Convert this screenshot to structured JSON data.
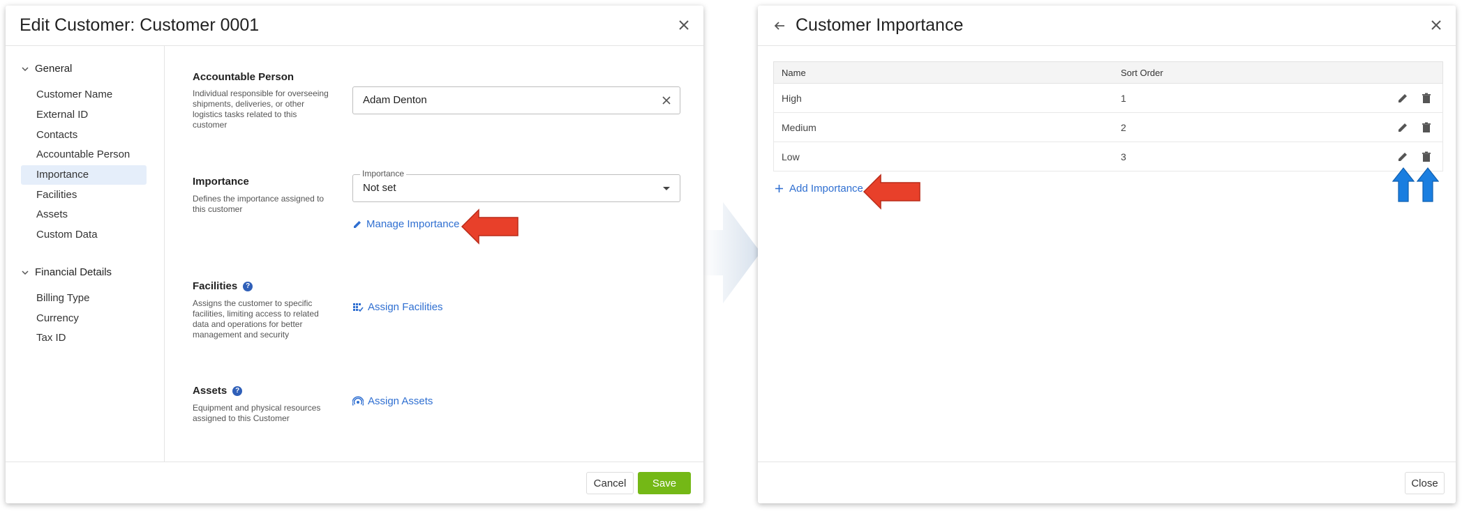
{
  "left_dialog": {
    "title": "Edit Customer: Customer 0001",
    "nav": {
      "general_label": "General",
      "general_items": [
        "Customer Name",
        "External ID",
        "Contacts",
        "Accountable Person",
        "Importance",
        "Facilities",
        "Assets",
        "Custom Data"
      ],
      "active_item": "Importance",
      "financial_label": "Financial Details",
      "financial_items": [
        "Billing Type",
        "Currency",
        "Tax ID"
      ]
    },
    "accountable": {
      "title": "Accountable Person",
      "description": "Individual responsible for overseeing shipments, deliveries, or other logistics tasks related to this customer",
      "value": "Adam Denton"
    },
    "importance": {
      "title": "Importance",
      "description": "Defines the importance assigned to this customer",
      "field_label": "Importance",
      "value": "Not set",
      "manage_link": "Manage Importance"
    },
    "facilities": {
      "title": "Facilities",
      "description": "Assigns the customer to specific facilities, limiting access to related data and operations for better management and security",
      "link": "Assign Facilities"
    },
    "assets": {
      "title": "Assets",
      "description": "Equipment and physical resources assigned to this Customer",
      "link": "Assign Assets"
    },
    "footer": {
      "cancel": "Cancel",
      "save": "Save"
    }
  },
  "right_dialog": {
    "title": "Customer Importance",
    "table": {
      "headers": [
        "Name",
        "Sort Order"
      ],
      "rows": [
        {
          "name": "High",
          "sort_order": "1"
        },
        {
          "name": "Medium",
          "sort_order": "2"
        },
        {
          "name": "Low",
          "sort_order": "3"
        }
      ]
    },
    "add_link": "Add Importance",
    "footer": {
      "close": "Close"
    }
  },
  "colors": {
    "accent_blue": "#2f6fd1",
    "save_green": "#74b816",
    "active_nav": "#e5eefa",
    "annotation_red": "#e8402a",
    "annotation_blue": "#1a7ee0"
  },
  "icons": [
    "close-icon",
    "chevron-down-icon",
    "clear-icon",
    "pencil-icon",
    "facilities-icon",
    "assets-icon",
    "help-icon",
    "back-arrow-icon",
    "edit-icon",
    "delete-icon",
    "plus-icon"
  ]
}
